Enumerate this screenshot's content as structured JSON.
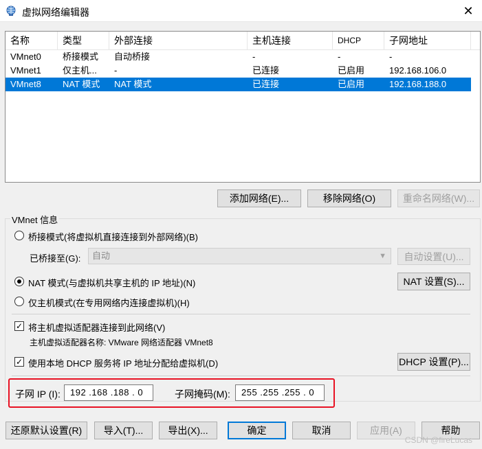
{
  "window": {
    "title": "虚拟网络编辑器",
    "close_glyph": "✕"
  },
  "columns": [
    "名称",
    "类型",
    "外部连接",
    "主机连接",
    "DHCP",
    "子网地址"
  ],
  "networks": [
    {
      "name": "VMnet0",
      "type": "桥接模式",
      "external": "自动桥接",
      "host": "-",
      "dhcp": "-",
      "subnet": "-"
    },
    {
      "name": "VMnet1",
      "type": "仅主机...",
      "external": "-",
      "host": "已连接",
      "dhcp": "已启用",
      "subnet": "192.168.106.0"
    },
    {
      "name": "VMnet8",
      "type": "NAT 模式",
      "external": "NAT 模式",
      "host": "已连接",
      "dhcp": "已启用",
      "subnet": "192.168.188.0"
    }
  ],
  "selected_network": "VMnet8",
  "list_buttons": {
    "add": "添加网络(E)...",
    "remove": "移除网络(O)",
    "rename": "重命名网络(W)..."
  },
  "vmnet_info": {
    "group_label": "VMnet 信息",
    "bridge_radio": "桥接模式(将虚拟机直接连接到外部网络)(B)",
    "bridged_to_label": "已桥接至(G):",
    "bridged_to_value": "自动",
    "auto_settings": "自动设置(U)...",
    "nat_radio": "NAT 模式(与虚拟机共享主机的 IP 地址)(N)",
    "nat_settings": "NAT 设置(S)...",
    "hostonly_radio": "仅主机模式(在专用网络内连接虚拟机)(H)",
    "selected_mode": "nat",
    "connect_adapter_check": "将主机虚拟适配器连接到此网络(V)",
    "connect_adapter_checked": true,
    "adapter_name": "主机虚拟适配器名称: VMware 网络适配器 VMnet8",
    "dhcp_check": "使用本地 DHCP 服务将 IP 地址分配给虚拟机(D)",
    "dhcp_checked": true,
    "dhcp_settings": "DHCP 设置(P)...",
    "subnet_ip_label": "子网 IP (I):",
    "subnet_ip_value": "192 .168 .188 . 0",
    "subnet_mask_label": "子网掩码(M):",
    "subnet_mask_value": "255 .255 .255 . 0"
  },
  "footer": {
    "restore": "还原默认设置(R)",
    "import": "导入(T)...",
    "export": "导出(X)...",
    "ok": "确定",
    "cancel": "取消",
    "apply": "应用(A)",
    "help": "帮助"
  },
  "watermark": "CSDN @fireLucas"
}
